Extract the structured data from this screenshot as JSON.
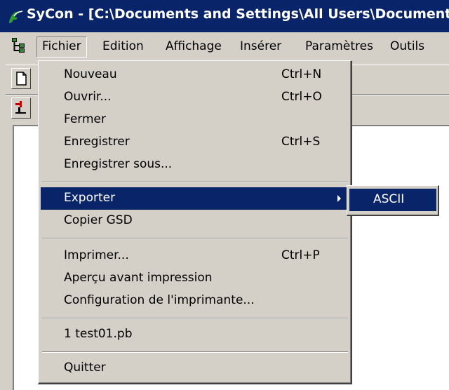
{
  "window": {
    "title": "SyCon - [C:\\Documents and Settings\\All Users\\Documents"
  },
  "menubar": {
    "items": [
      {
        "label": "Fichier"
      },
      {
        "label": "Edition"
      },
      {
        "label": "Affichage"
      },
      {
        "label": "Insérer"
      },
      {
        "label": "Paramètres"
      },
      {
        "label": "Outils"
      }
    ]
  },
  "file_menu": {
    "items": [
      {
        "label": "Nouveau",
        "shortcut": "Ctrl+N"
      },
      {
        "label": "Ouvrir...",
        "shortcut": "Ctrl+O"
      },
      {
        "label": "Fermer",
        "shortcut": ""
      },
      {
        "label": "Enregistrer",
        "shortcut": "Ctrl+S"
      },
      {
        "label": "Enregistrer sous...",
        "shortcut": ""
      },
      {
        "label": "Exporter",
        "shortcut": ""
      },
      {
        "label": "Copier GSD",
        "shortcut": ""
      },
      {
        "label": "Imprimer...",
        "shortcut": "Ctrl+P"
      },
      {
        "label": "Aperçu avant impression",
        "shortcut": ""
      },
      {
        "label": "Configuration de l'imprimante...",
        "shortcut": ""
      },
      {
        "label": "1 test01.pb",
        "shortcut": ""
      },
      {
        "label": "Quitter",
        "shortcut": ""
      }
    ]
  },
  "export_submenu": {
    "items": [
      {
        "label": "ASCII"
      }
    ]
  },
  "colors": {
    "title_bar": "#0a246a",
    "highlight": "#0a246a",
    "face": "#d4d0c8"
  }
}
